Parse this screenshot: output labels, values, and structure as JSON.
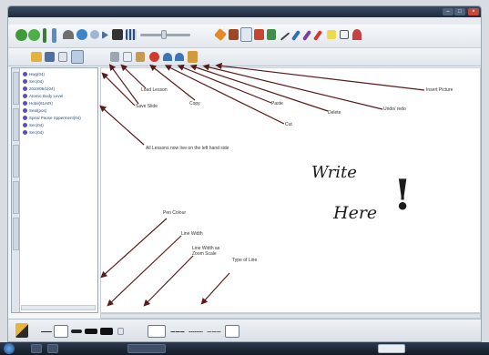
{
  "window": {
    "title": ""
  },
  "sidebar": {
    "items": [
      "Hwg(04)",
      "Sec(04)",
      "2010/05/1(04)",
      "Atomic Body Level",
      "Hotel(81AIR)",
      "Seal(pos)",
      "Spiral Pause Spperment(04)",
      "Sec(04)",
      "Sec(04)"
    ]
  },
  "canvas": {
    "handwriting_line1": "Write",
    "handwriting_line2": "Here",
    "handwriting_mark": "!"
  },
  "annotations": {
    "insert_picture": "Insert Picture",
    "undo_redo": "Undo/ redo",
    "delete": "Delete",
    "paste": "Paste",
    "copy": "Copy",
    "cut": "Cut",
    "load_lesson": "Load Lesson",
    "save_slide": "Save Slide",
    "all_lessons": "All Lessons now live on the left hand side",
    "pen_colour": "Pen Colour",
    "line_width": "Line Width",
    "line_width_zoom_1": "Line Width as",
    "line_width_zoom_2": "Zoom Scale",
    "type_of_line": "Type of Line"
  },
  "colors": {
    "arrow": "#5a1a1a",
    "ink": "#1c1c1c",
    "title_bar": "#1f2b3b"
  }
}
